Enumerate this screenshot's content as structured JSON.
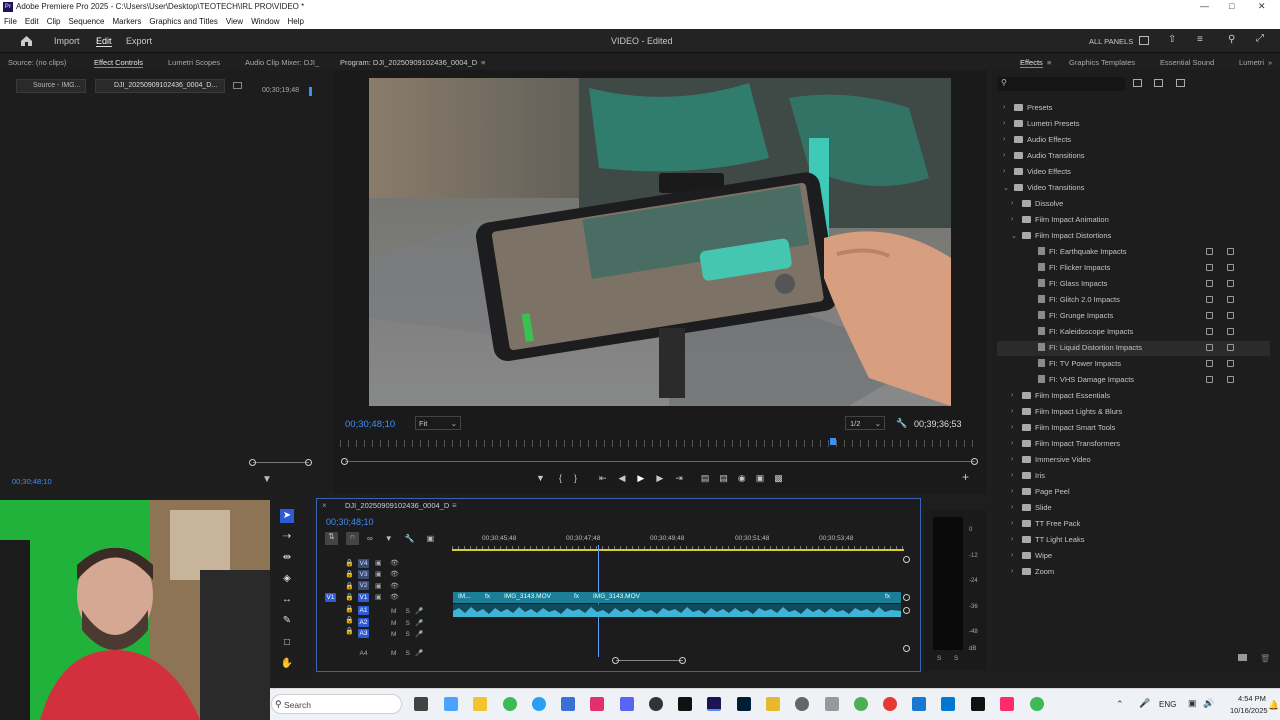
{
  "window": {
    "title": "Adobe Premiere Pro 2025 - C:\\Users\\User\\Desktop\\TEOTECH\\IRL PRO\\VIDEO *",
    "app_badge": "Pr"
  },
  "menu": [
    "File",
    "Edit",
    "Clip",
    "Sequence",
    "Markers",
    "Graphics and Titles",
    "View",
    "Window",
    "Help"
  ],
  "workspace": {
    "import": "Import",
    "edit": "Edit",
    "export": "Export",
    "doc_title": "VIDEO - Edited",
    "all_panels": "ALL PANELS"
  },
  "left_panel": {
    "tabs": [
      "Source: (no clips)",
      "Effect Controls",
      "Lumetri Scopes",
      "Audio Clip Mixer: DJI_"
    ],
    "source_label": "Source - IMG...",
    "clip_label": "DJI_20250909102436_0004_D...",
    "timecode": "00;30;19;48",
    "bottom_timecode": "00;30;48;10"
  },
  "program": {
    "title": "Program: DJI_20250909102436_0004_D",
    "current_tc": "00;30;48;10",
    "fit": "Fit",
    "resolution": "1/2",
    "duration": "00;39;36;53"
  },
  "timeline": {
    "sequence": "DJI_20250909102436_0004_D",
    "current_tc": "00;30;48;10",
    "ruler": [
      "00;30;45;48",
      "00;30;47;48",
      "00;30;49;48",
      "00;30;51;48",
      "00;30;53;48"
    ],
    "video_tracks": [
      "V4",
      "V3",
      "V2",
      "V1"
    ],
    "audio_tracks": [
      "A1",
      "A2",
      "A3",
      "A4"
    ],
    "clip_short": "IM...",
    "clip1": "IMG_3143.MOV",
    "clip2": "IMG_3143.MOV",
    "fx": "fx",
    "meter": [
      "0",
      "-12",
      "-24",
      "-36",
      "-48",
      "dB"
    ],
    "solo": [
      "S",
      "S"
    ]
  },
  "effects": {
    "tabs": [
      "Effects",
      "Graphics Templates",
      "Essential Sound",
      "Lumetri"
    ],
    "tree": [
      {
        "label": "Presets",
        "level": 0,
        "type": "folder",
        "open": false
      },
      {
        "label": "Lumetri Presets",
        "level": 0,
        "type": "folder",
        "open": false
      },
      {
        "label": "Audio Effects",
        "level": 0,
        "type": "folder",
        "open": false
      },
      {
        "label": "Audio Transitions",
        "level": 0,
        "type": "folder",
        "open": false
      },
      {
        "label": "Video Effects",
        "level": 0,
        "type": "folder",
        "open": false
      },
      {
        "label": "Video Transitions",
        "level": 0,
        "type": "folder",
        "open": true
      },
      {
        "label": "Dissolve",
        "level": 1,
        "type": "folder",
        "open": false
      },
      {
        "label": "Film Impact Animation",
        "level": 1,
        "type": "folder",
        "open": false
      },
      {
        "label": "Film Impact Distortions",
        "level": 1,
        "type": "folder",
        "open": true
      },
      {
        "label": "FI: Earthquake Impacts",
        "level": 2,
        "type": "effect"
      },
      {
        "label": "FI: Flicker Impacts",
        "level": 2,
        "type": "effect"
      },
      {
        "label": "FI: Glass Impacts",
        "level": 2,
        "type": "effect"
      },
      {
        "label": "FI: Glitch 2.0 Impacts",
        "level": 2,
        "type": "effect"
      },
      {
        "label": "FI: Grunge Impacts",
        "level": 2,
        "type": "effect"
      },
      {
        "label": "FI: Kaleidoscope Impacts",
        "level": 2,
        "type": "effect"
      },
      {
        "label": "FI: Liquid Distortion Impacts",
        "level": 2,
        "type": "effect",
        "selected": true
      },
      {
        "label": "FI: TV Power Impacts",
        "level": 2,
        "type": "effect"
      },
      {
        "label": "FI: VHS Damage Impacts",
        "level": 2,
        "type": "effect"
      },
      {
        "label": "Film Impact Essentials",
        "level": 1,
        "type": "folder",
        "open": false
      },
      {
        "label": "Film Impact Lights & Blurs",
        "level": 1,
        "type": "folder",
        "open": false
      },
      {
        "label": "Film Impact Smart Tools",
        "level": 1,
        "type": "folder",
        "open": false
      },
      {
        "label": "Film Impact Transformers",
        "level": 1,
        "type": "folder",
        "open": false
      },
      {
        "label": "Immersive Video",
        "level": 1,
        "type": "folder",
        "open": false
      },
      {
        "label": "Iris",
        "level": 1,
        "type": "folder",
        "open": false
      },
      {
        "label": "Page Peel",
        "level": 1,
        "type": "folder",
        "open": false
      },
      {
        "label": "Slide",
        "level": 1,
        "type": "folder",
        "open": false
      },
      {
        "label": "TT Free Pack",
        "level": 1,
        "type": "folder",
        "open": false
      },
      {
        "label": "TT Light Leaks",
        "level": 1,
        "type": "folder",
        "open": false
      },
      {
        "label": "Wipe",
        "level": 1,
        "type": "folder",
        "open": false
      },
      {
        "label": "Zoom",
        "level": 1,
        "type": "folder",
        "open": false
      }
    ]
  },
  "taskbar": {
    "search": "Search",
    "lang": "ENG",
    "time": "4:54 PM",
    "date": "10/16/2025"
  },
  "colors": {
    "accent": "#3e8ef7",
    "clip": "#1b7f98",
    "audio_wave": "#3fb4d4"
  }
}
